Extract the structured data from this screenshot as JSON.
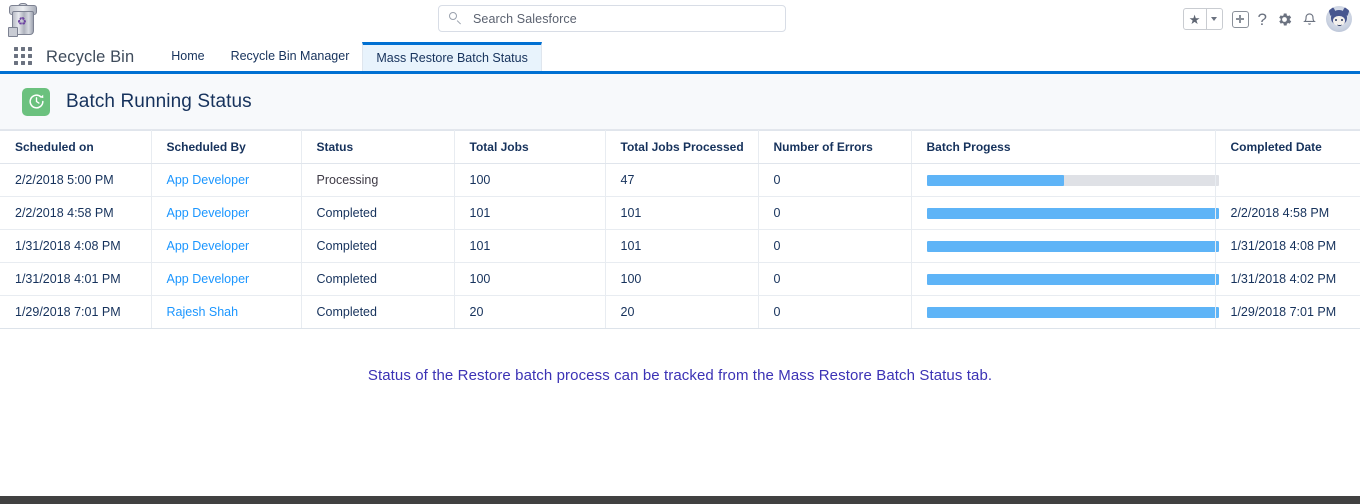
{
  "header": {
    "logo_icon": "recycle-bin-logo",
    "search": {
      "placeholder": "Search Salesforce",
      "value": "",
      "icon": "search-icon"
    },
    "icons": [
      {
        "name": "favorites-star-icon",
        "glyph": "★"
      },
      {
        "name": "favorites-dropdown-caret-icon"
      },
      {
        "name": "add-icon"
      },
      {
        "name": "help-icon",
        "glyph": "?"
      },
      {
        "name": "setup-gear-icon"
      },
      {
        "name": "notifications-bell-icon"
      },
      {
        "name": "user-avatar"
      }
    ]
  },
  "nav": {
    "waffle_icon": "app-launcher-icon",
    "app_name": "Recycle Bin",
    "tabs": [
      {
        "label": "Home",
        "active": false
      },
      {
        "label": "Recycle Bin Manager",
        "active": false
      },
      {
        "label": "Mass Restore Batch Status",
        "active": true
      }
    ]
  },
  "page": {
    "icon": "batch-history-clock-icon",
    "icon_color": "#6bc17e",
    "title": "Batch Running Status"
  },
  "table": {
    "columns": [
      "Scheduled on",
      "Scheduled By",
      "Status",
      "Total Jobs",
      "Total Jobs Processed",
      "Number of Errors",
      "Batch Progess",
      "Completed Date"
    ],
    "rows": [
      {
        "scheduled_on": "2/2/2018 5:00 PM",
        "scheduled_by": "App Developer",
        "status": "Processing",
        "total_jobs": "100",
        "total_jobs_processed": "47",
        "number_of_errors": "0",
        "progress_percent": 47,
        "completed_date": ""
      },
      {
        "scheduled_on": "2/2/2018 4:58 PM",
        "scheduled_by": "App Developer",
        "status": "Completed",
        "total_jobs": "101",
        "total_jobs_processed": "101",
        "number_of_errors": "0",
        "progress_percent": 100,
        "completed_date": "2/2/2018 4:58 PM"
      },
      {
        "scheduled_on": "1/31/2018 4:08 PM",
        "scheduled_by": "App Developer",
        "status": "Completed",
        "total_jobs": "101",
        "total_jobs_processed": "101",
        "number_of_errors": "0",
        "progress_percent": 100,
        "completed_date": "1/31/2018 4:08 PM"
      },
      {
        "scheduled_on": "1/31/2018 4:01 PM",
        "scheduled_by": "App Developer",
        "status": "Completed",
        "total_jobs": "100",
        "total_jobs_processed": "100",
        "number_of_errors": "0",
        "progress_percent": 100,
        "completed_date": "1/31/2018 4:02 PM"
      },
      {
        "scheduled_on": "1/29/2018 7:01 PM",
        "scheduled_by": "Rajesh Shah",
        "status": "Completed",
        "total_jobs": "20",
        "total_jobs_processed": "20",
        "number_of_errors": "0",
        "progress_percent": 100,
        "completed_date": "1/29/2018 7:01 PM"
      }
    ]
  },
  "caption": {
    "text": "Status of the Restore batch process can be tracked from the Mass Restore Batch Status tab.",
    "color": "#3b32b5"
  }
}
